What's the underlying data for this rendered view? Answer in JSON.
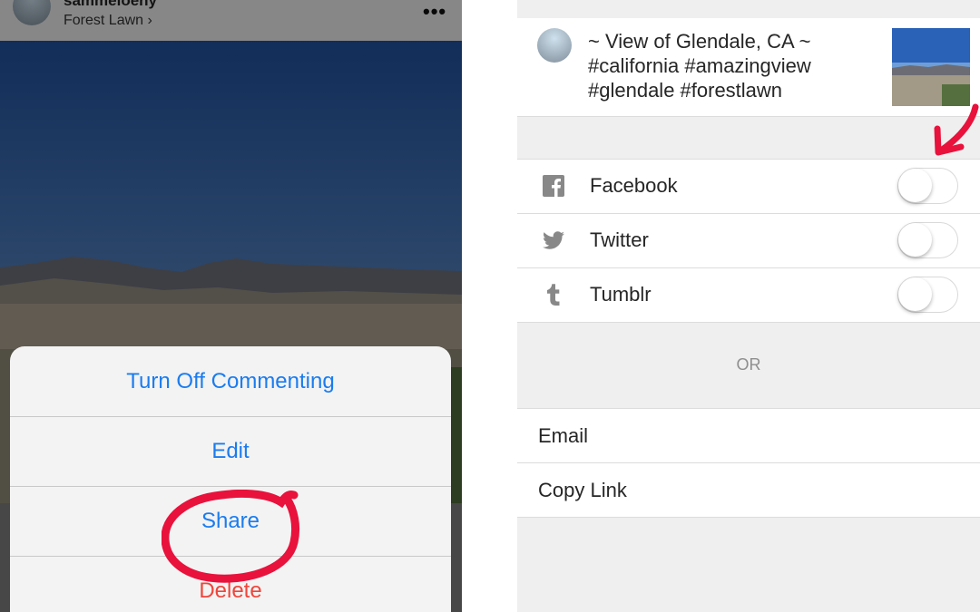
{
  "left": {
    "post": {
      "username": "sammeloeny",
      "location": "Forest Lawn",
      "location_chevron": "›",
      "more_icon": "more-dots-icon",
      "more_label": "•••"
    },
    "action_sheet": {
      "items": [
        {
          "label": "Turn Off Commenting"
        },
        {
          "label": "Edit"
        },
        {
          "label": "Share"
        },
        {
          "label": "Delete"
        }
      ]
    },
    "colors": {
      "accent": "#1a7cf0",
      "destructive": "#f0453b",
      "annotation": "#e8123c"
    }
  },
  "right": {
    "caption": {
      "text_line1": "~ View of Glendale, CA ~",
      "text_line2": "#california #amazingview",
      "text_line3": "#glendale #forestlawn"
    },
    "share_targets": [
      {
        "label": "Facebook",
        "icon": "facebook-icon",
        "enabled": false
      },
      {
        "label": "Twitter",
        "icon": "twitter-icon",
        "enabled": false
      },
      {
        "label": "Tumblr",
        "icon": "tumblr-icon",
        "enabled": false
      }
    ],
    "or_label": "OR",
    "links": [
      {
        "label": "Email"
      },
      {
        "label": "Copy Link"
      }
    ]
  }
}
